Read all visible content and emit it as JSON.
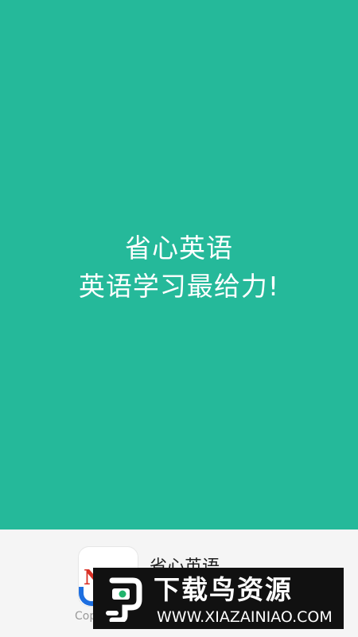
{
  "splash": {
    "line1": "省心英语",
    "line2": "英语学习最给力!",
    "background": "#25b99a"
  },
  "footer": {
    "icon": "app-logo-icon",
    "app_name": "省心英语",
    "copyright": "Cop"
  },
  "watermark": {
    "icon": "bird-logo-icon",
    "title": "下载鸟资源",
    "url": "WWW.XIAZAINIAO.COM"
  }
}
